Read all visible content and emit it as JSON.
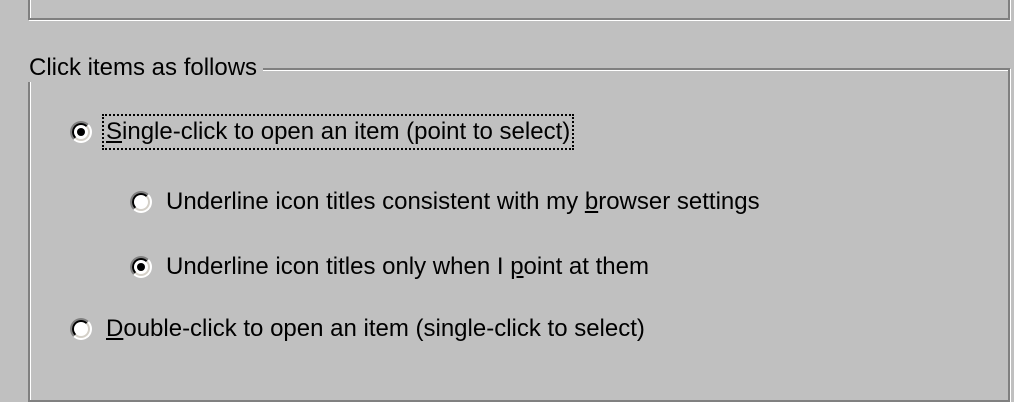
{
  "group": {
    "title": "Click items as follows"
  },
  "options": {
    "single_click": {
      "pre": "",
      "accel": "S",
      "post": "ingle-click to open an item (point to select)",
      "selected": true
    },
    "underline_browser": {
      "pre": "Underline icon titles consistent with my ",
      "accel": "b",
      "post": "rowser settings",
      "selected": false
    },
    "underline_point": {
      "pre": "Underline icon titles only when I ",
      "accel": "p",
      "post": "oint at them",
      "selected": true
    },
    "double_click": {
      "pre": "",
      "accel": "D",
      "post": "ouble-click to open an item (single-click to select)",
      "selected": false
    }
  }
}
